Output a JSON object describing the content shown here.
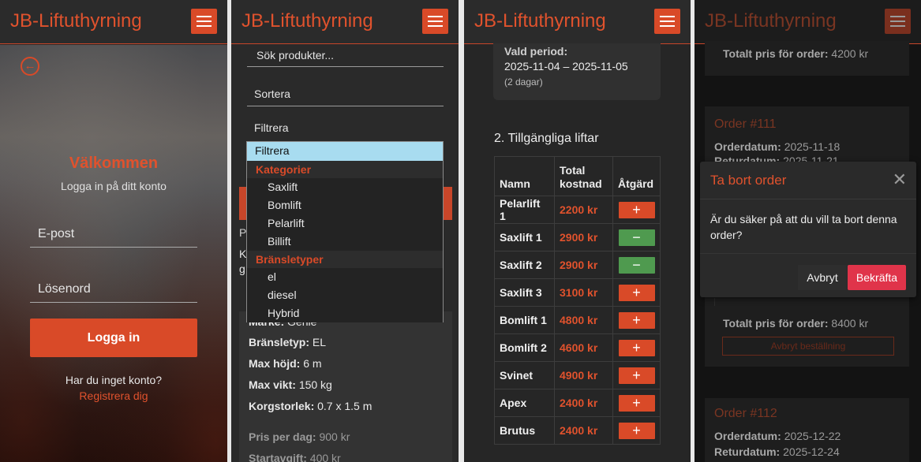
{
  "app": {
    "brand": "JB-Liftuthyrning"
  },
  "login": {
    "title": "Välkommen",
    "subtitle": "Logga in på ditt konto",
    "email_placeholder": "E-post",
    "password_placeholder": "Lösenord",
    "submit_label": "Logga in",
    "no_account_text": "Har du inget konto?",
    "register_link": "Registrera dig"
  },
  "products": {
    "search_placeholder": "Sök produkter...",
    "sort_label": "Sortera",
    "filter_label": "Filtrera",
    "dropdown": {
      "selected": "Filtrera",
      "groups": [
        {
          "label": "Kategorier",
          "options": [
            "Saxlift",
            "Bomlift",
            "Pelarlift",
            "Billift"
          ]
        },
        {
          "label": "Bränsletyper",
          "options": [
            "el",
            "diesel",
            "Hybrid"
          ]
        }
      ]
    },
    "background_fragments": [
      "P",
      "K",
      "g"
    ],
    "spec_partial": {
      "label": "Märke:",
      "value": "Genie"
    },
    "specs": [
      {
        "label": "Bränsletyp:",
        "value": "EL"
      },
      {
        "label": "Max höjd:",
        "value": "6 m"
      },
      {
        "label": "Max vikt:",
        "value": "150 kg"
      },
      {
        "label": "Korgstorlek:",
        "value": "0.7 x 1.5 m"
      }
    ],
    "price": {
      "label": "Pris per dag:",
      "value": "900 kr"
    },
    "start_fee": {
      "label": "Startavgift:",
      "value": "400 kr"
    }
  },
  "booking": {
    "period_label": "Vald period:",
    "period_value": "2025-11-04 – 2025-11-05",
    "period_days": "(2 dagar)",
    "section_title": "2. Tillgängliga liftar",
    "columns": {
      "name": "Namn",
      "cost": "Total kostnad",
      "action": "Åtgärd"
    },
    "rows": [
      {
        "name": "Pelarlift 1",
        "cost": "2200 kr",
        "action": "add"
      },
      {
        "name": "Saxlift 1",
        "cost": "2900 kr",
        "action": "remove"
      },
      {
        "name": "Saxlift 2",
        "cost": "2900 kr",
        "action": "remove"
      },
      {
        "name": "Saxlift 3",
        "cost": "3100 kr",
        "action": "add"
      },
      {
        "name": "Bomlift 1",
        "cost": "4800 kr",
        "action": "add"
      },
      {
        "name": "Bomlift 2",
        "cost": "4600 kr",
        "action": "add"
      },
      {
        "name": "Svinet",
        "cost": "4900 kr",
        "action": "add"
      },
      {
        "name": "Apex",
        "cost": "2400 kr",
        "action": "add"
      },
      {
        "name": "Brutus",
        "cost": "2400 kr",
        "action": "add"
      }
    ],
    "add_symbol": "+",
    "remove_symbol": "−"
  },
  "orders": {
    "top_total": {
      "label": "Totalt pris för order:",
      "value": "4200 kr"
    },
    "order1": {
      "title": "Order #111",
      "order_date": {
        "label": "Orderdatum:",
        "value": "2025-11-18"
      },
      "return_date_partial": {
        "label": "Returdatum:",
        "value": "2025-11-21"
      },
      "total": {
        "label": "Totalt pris för order:",
        "value": "8400 kr"
      },
      "cancel_label": "Avbryt beställning"
    },
    "order2": {
      "title": "Order #112",
      "order_date": {
        "label": "Orderdatum:",
        "value": "2025-12-22"
      },
      "return_date": {
        "label": "Returdatum:",
        "value": "2025-12-24"
      }
    },
    "modal": {
      "title": "Ta bort order",
      "close_symbol": "✕",
      "body": "Är du säker på att du vill ta bort denna order?",
      "cancel_label": "Avbryt",
      "confirm_label": "Bekräfta"
    }
  },
  "colors": {
    "accent": "#d94a28",
    "accent_text": "#e0522d",
    "success": "#4f9a4f",
    "danger": "#e0344a",
    "dropdown_highlight": "#a8dcf0"
  }
}
